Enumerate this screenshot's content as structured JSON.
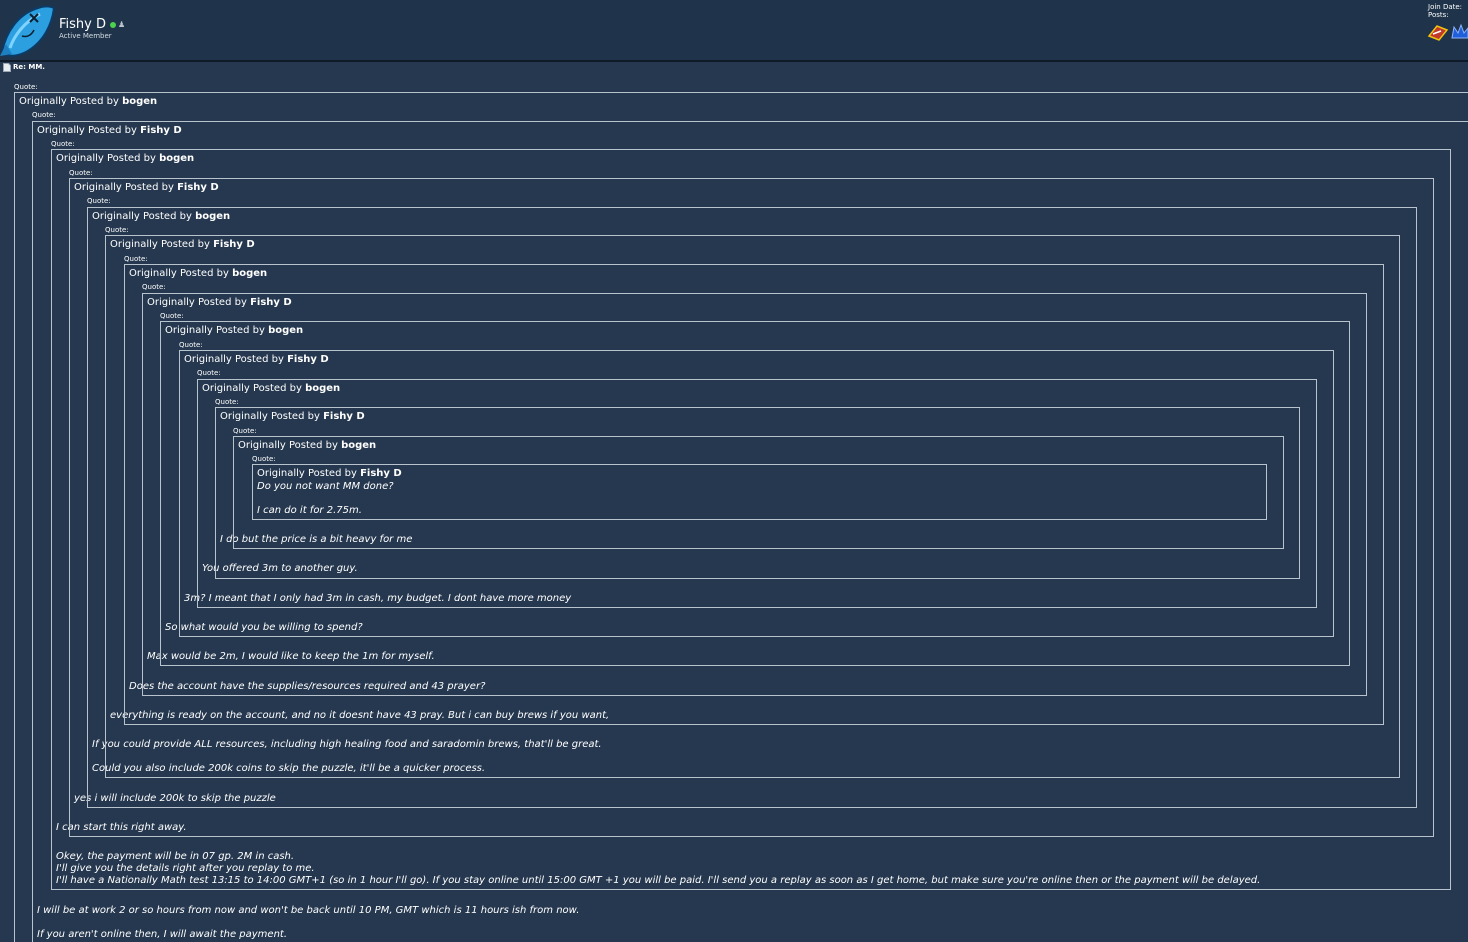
{
  "user": {
    "name": "Fishy D",
    "title": "Active Member",
    "join_label": "Join Date:",
    "posts_label": "Posts:"
  },
  "post": {
    "title": "Re: MM."
  },
  "quote_label": "Quote:",
  "originally_posted_by": "Originally Posted by",
  "quotes": [
    {
      "author": "bogen",
      "lines": [
        "I will be at work 2 or so hours from now and won't be back until 10 PM, GMT which is 11 hours ish from now.",
        "If you aren't online then, I will await the payment."
      ]
    },
    {
      "author": "Fishy D",
      "lines": [
        "Okey, the payment will be in 07 gp. 2M in cash.",
        "I'll give you the details right after you replay to me.",
        "I'll have a Nationally Math test 13:15 to 14:00 GMT+1 (so in 1 hour I'll go). If you stay online until 15:00 GMT +1 you will be paid. I'll send you a replay as soon as I get home, but make sure you're online then or the payment will be delayed."
      ]
    },
    {
      "author": "bogen",
      "lines": [
        "I can start this right away."
      ]
    },
    {
      "author": "Fishy D",
      "lines": [
        "yes i will include 200k to skip the puzzle"
      ]
    },
    {
      "author": "bogen",
      "lines": [
        "If you could provide ALL resources, including high healing food and saradomin brews, that'll be great.",
        "Could you also include 200k coins to skip the puzzle, it'll be a quicker process."
      ]
    },
    {
      "author": "Fishy D",
      "lines": [
        "everything is ready on the account, and no it doesnt have 43 pray. But i can buy brews if you want,"
      ]
    },
    {
      "author": "bogen",
      "lines": [
        "Does the account have the supplies/resources required and 43 prayer?"
      ]
    },
    {
      "author": "Fishy D",
      "lines": [
        "Max would be 2m, I would like to keep the 1m for myself."
      ]
    },
    {
      "author": "bogen",
      "lines": [
        "So what would you be willing to spend?"
      ]
    },
    {
      "author": "Fishy D",
      "lines": [
        "3m? I meant that I only had 3m in cash, my budget. I dont have more money"
      ]
    },
    {
      "author": "bogen",
      "lines": [
        "You offered 3m to another guy."
      ]
    },
    {
      "author": "Fishy D",
      "lines": [
        "I do but the price is a bit heavy for me"
      ]
    },
    {
      "author": "bogen",
      "lines": []
    },
    {
      "author": "Fishy D",
      "lines": [
        "Do you not want MM done?",
        "I can do it for 2.75m."
      ]
    }
  ],
  "colors": {
    "background": "#26384f",
    "header": "#1f344b",
    "border": "#b9c3cd"
  }
}
